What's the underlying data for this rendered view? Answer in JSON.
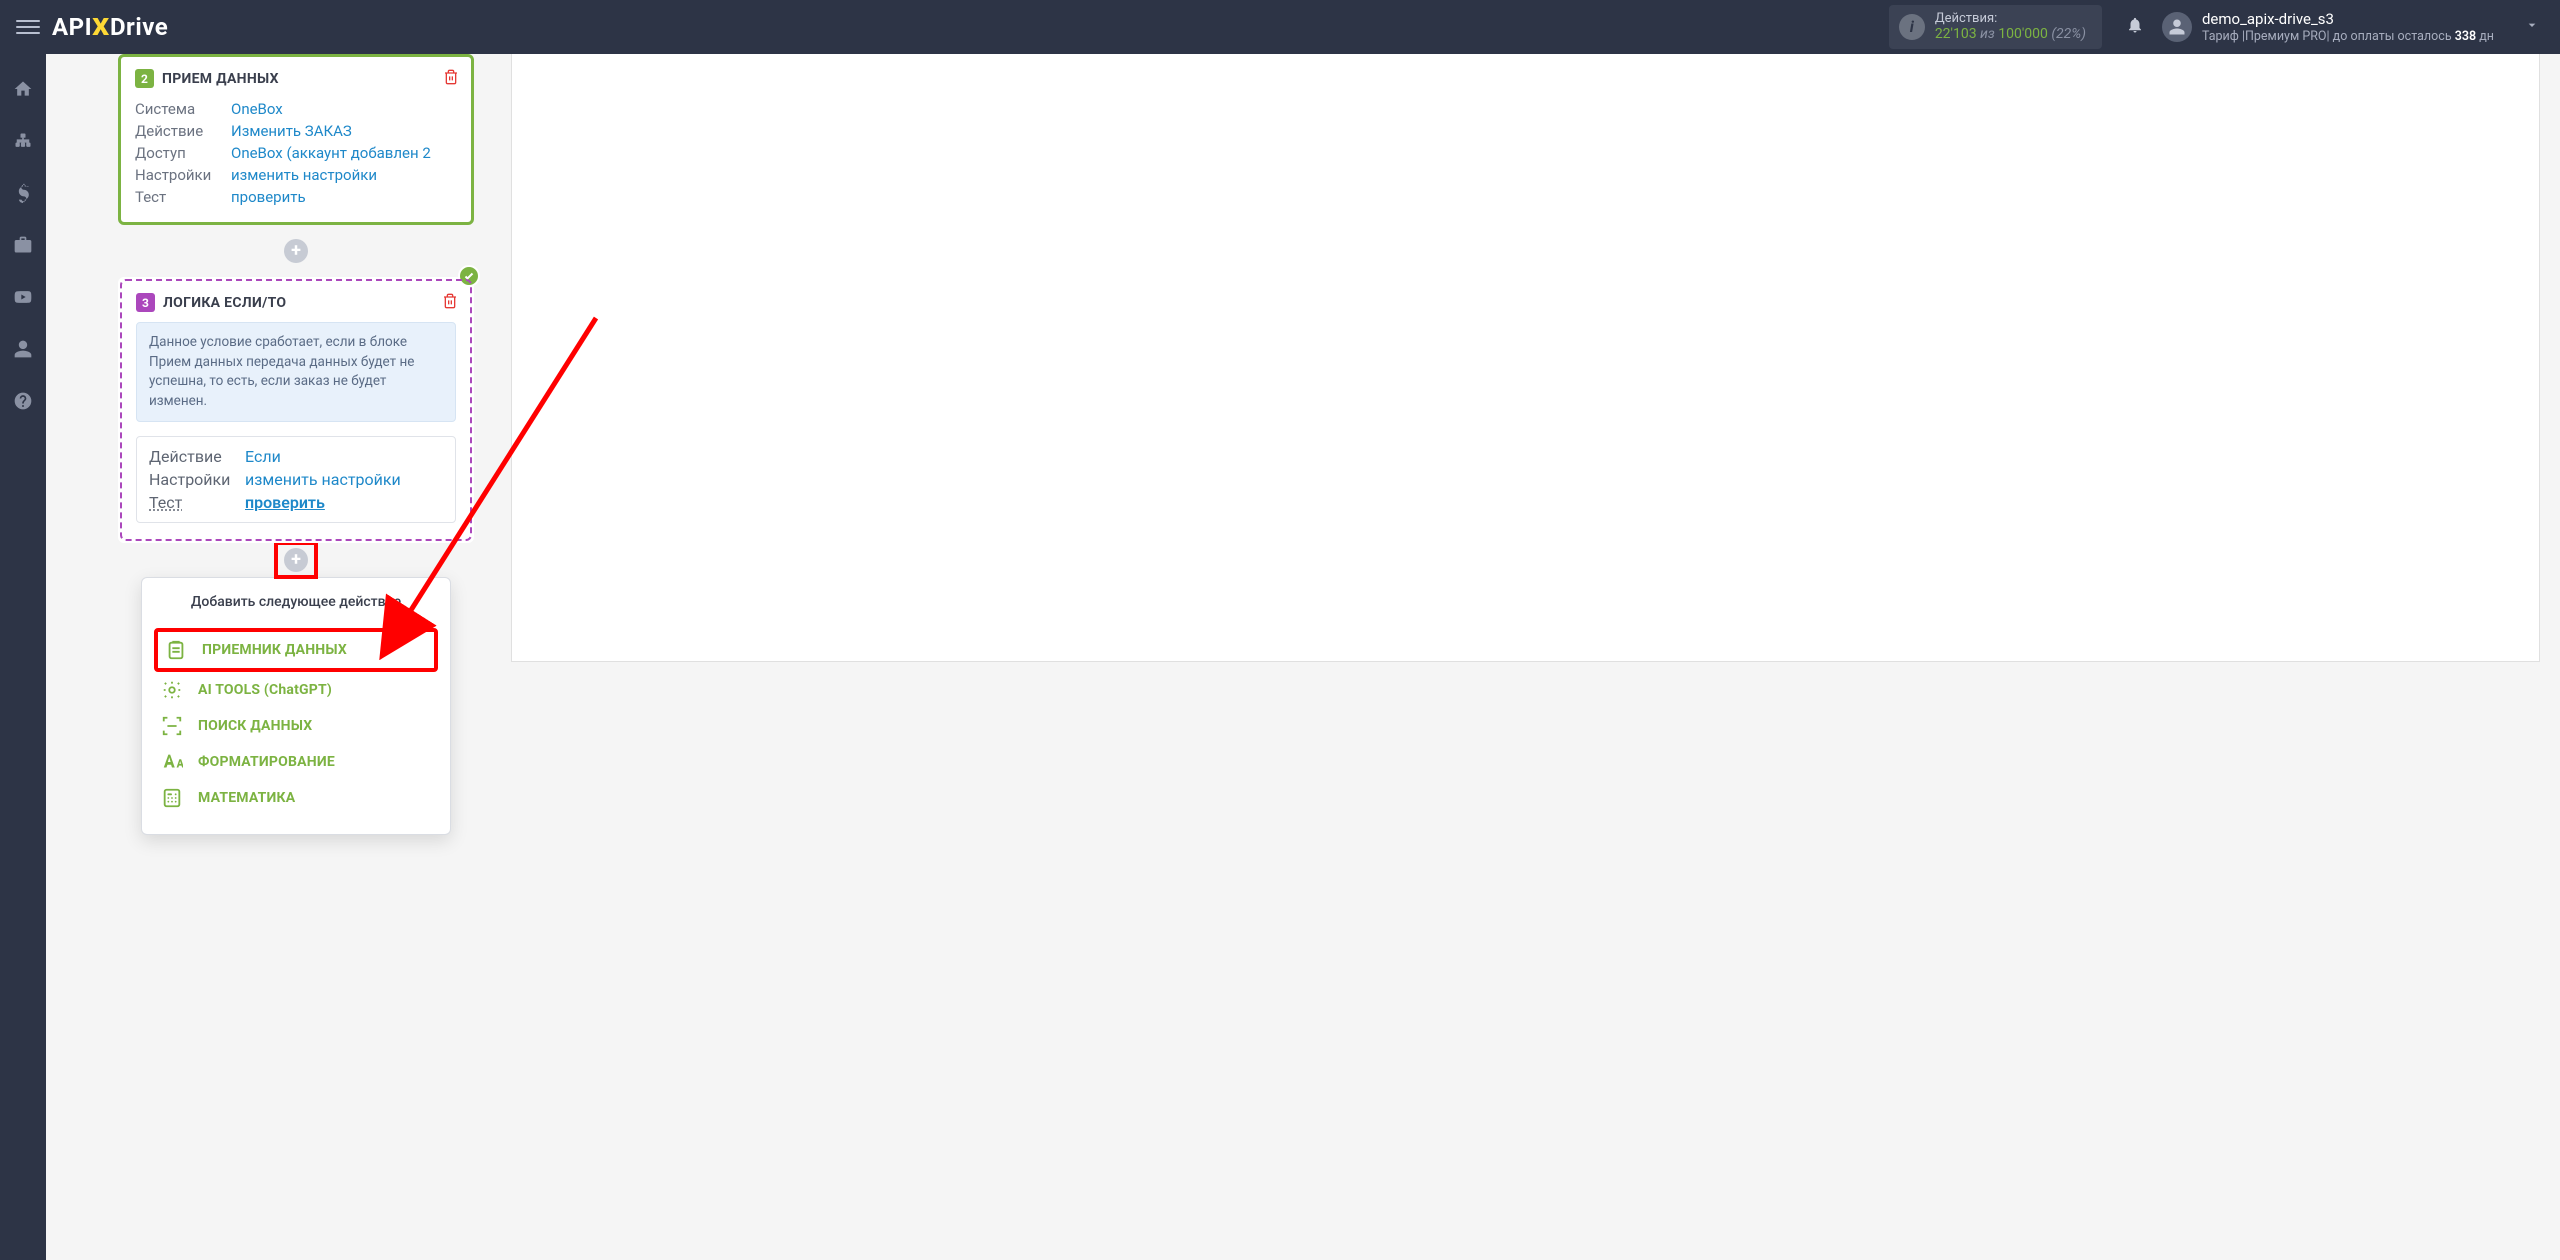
{
  "brand": {
    "api": "API",
    "x": "X",
    "drive": "Drive"
  },
  "header": {
    "actions_label": "Действия:",
    "actions_used": "22'103",
    "actions_of": " из ",
    "actions_total": "100'000",
    "actions_percent": "(22%)",
    "user_name": "demo_apix-drive_s3",
    "tariff_prefix": "Тариф |Премиум PRO| до оплаты осталось ",
    "tariff_days": "338",
    "tariff_days_unit": " дн"
  },
  "step2": {
    "num": "2",
    "title": "ПРИЕМ ДАННЫХ",
    "rows": {
      "system_label": "Система",
      "system_value": "OneBox",
      "action_label": "Действие",
      "action_value": "Изменить ЗАКАЗ",
      "access_label": "Доступ",
      "access_value": "OneBox (аккаунт добавлен 2",
      "settings_label": "Настройки",
      "settings_value": "изменить настройки",
      "test_label": "Тест",
      "test_value": "проверить"
    }
  },
  "step3": {
    "num": "3",
    "title": "ЛОГИКА ЕСЛИ/ТО",
    "description": "Данное условие сработает, если в блоке Прием данных передача данных будет не успешна, то есть, если заказ не будет изменен.",
    "rows": {
      "action_label": "Действие",
      "action_value": "Если",
      "settings_label": "Настройки",
      "settings_value": "изменить настройки",
      "test_label": "Тест",
      "test_value": "проверить"
    }
  },
  "dropdown": {
    "title": "Добавить следующее действие",
    "items": {
      "receiver": "ПРИЕМНИК ДАННЫХ",
      "ai": "AI TOOLS (ChatGPT)",
      "search": "ПОИСК ДАННЫХ",
      "format": "ФОРМАТИРОВАНИЕ",
      "math": "МАТЕМАТИКА"
    }
  }
}
